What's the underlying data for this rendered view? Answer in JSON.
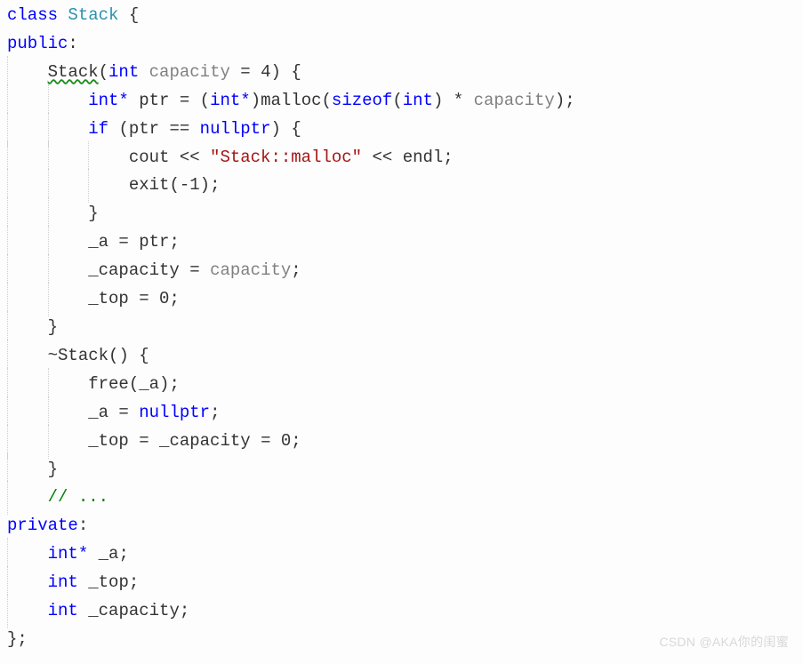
{
  "code": {
    "line1_class": "class",
    "line1_name": "Stack",
    "lbrace": "{",
    "rbrace": "}",
    "public": "public",
    "private": "private",
    "colon": ":",
    "ctor_name": "Stack",
    "lparen": "(",
    "rparen": ")",
    "int": "int",
    "intptr": "int*",
    "capacity": "capacity",
    "eq": " = ",
    "default_val": "4",
    "ptr": "ptr",
    "malloc": "malloc",
    "sizeof": "sizeof",
    "star": " * ",
    "semi": ";",
    "if": "if",
    "eqeq": " == ",
    "nullptr": "nullptr",
    "cout": "cout",
    "lshift": " << ",
    "msg": "\"Stack::malloc\"",
    "endl": "endl",
    "exit": "exit",
    "neg1": "-1",
    "a": "_a",
    "cap": "_capacity",
    "top": "_top",
    "zero": "0",
    "dtor": "~Stack",
    "free": "free",
    "comment": "// ...",
    "end": "};"
  },
  "watermark": "CSDN @AKA你的闺蜜"
}
